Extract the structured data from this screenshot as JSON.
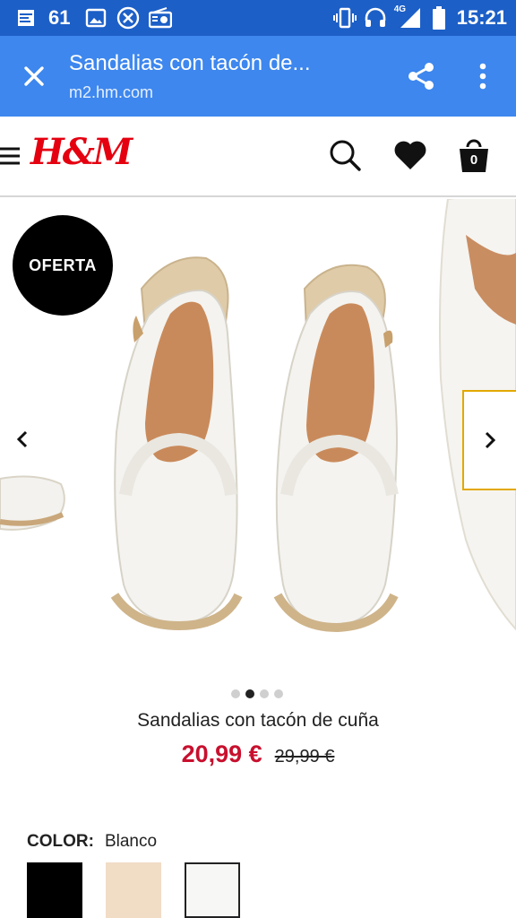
{
  "status_bar": {
    "notification_count": "61",
    "network": "4G",
    "time": "15:21",
    "icons": [
      "sim-icon",
      "image-icon",
      "blocked-icon",
      "radio-icon",
      "vibrate-icon",
      "headset-icon",
      "signal-icon",
      "battery-icon"
    ]
  },
  "browser": {
    "page_title": "Sandalias con tacón de...",
    "url": "m2.hm.com"
  },
  "header": {
    "logo": "H&M",
    "cart_count": "0"
  },
  "product": {
    "badge": "OFERTA",
    "name": "Sandalias con tacón de cuña",
    "price_sale": "20,99 €",
    "price_old": "29,99 €",
    "image_count": 4,
    "active_image": 2,
    "color_label": "COLOR:",
    "color_value": "Blanco",
    "swatches": [
      "black",
      "beige",
      "white"
    ]
  },
  "colors": {
    "status_bar": "#1c5fc7",
    "toolbar": "#3d87ee",
    "brand_red": "#e50010",
    "sale_red": "#c8102e"
  }
}
